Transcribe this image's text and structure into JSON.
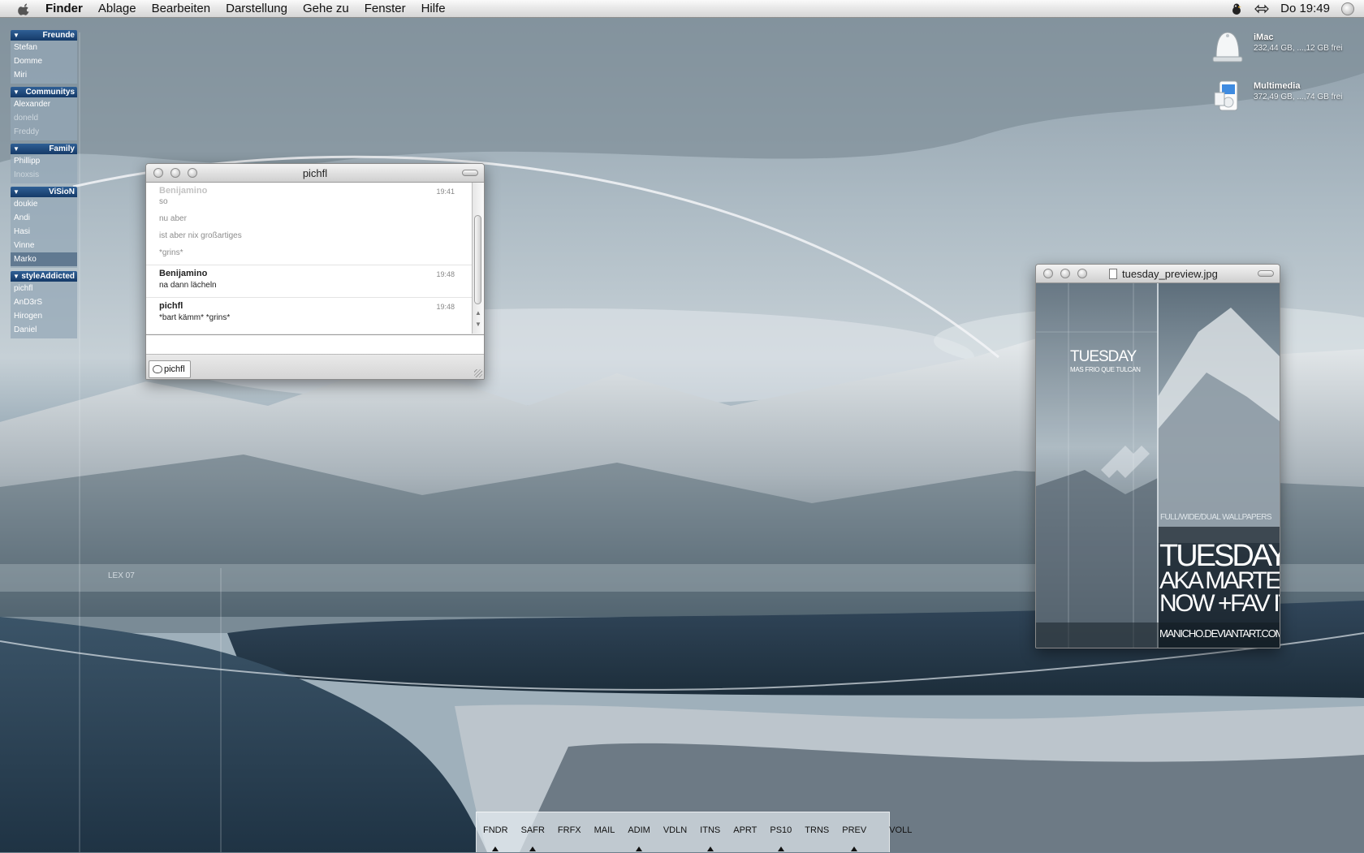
{
  "menubar": {
    "items": [
      "Finder",
      "Ablage",
      "Bearbeiten",
      "Darstellung",
      "Gehe zu",
      "Fenster",
      "Hilfe"
    ],
    "clock": "Do 19:49"
  },
  "buddy_list": {
    "groups": [
      {
        "name": "Freunde",
        "buddies": [
          {
            "name": "Stefan",
            "status": "online"
          },
          {
            "name": "Domme",
            "status": "online"
          },
          {
            "name": "Miri",
            "status": "online"
          }
        ]
      },
      {
        "name": "Communitys",
        "buddies": [
          {
            "name": "Alexander",
            "status": "online"
          },
          {
            "name": "doneld",
            "status": "away"
          },
          {
            "name": "Freddy",
            "status": "away"
          }
        ]
      },
      {
        "name": "Family",
        "buddies": [
          {
            "name": "Phillipp",
            "status": "online"
          },
          {
            "name": "Inoxsis",
            "status": "away"
          }
        ]
      },
      {
        "name": "ViSioN",
        "buddies": [
          {
            "name": "doukie",
            "status": "online"
          },
          {
            "name": "Andi",
            "status": "online"
          },
          {
            "name": "Hasi",
            "status": "online"
          },
          {
            "name": "Vinne",
            "status": "online"
          },
          {
            "name": "Marko",
            "status": "selected"
          }
        ]
      },
      {
        "name": "styleAddicted",
        "buddies": [
          {
            "name": "pichfl",
            "status": "online"
          },
          {
            "name": "AnD3rS",
            "status": "online"
          },
          {
            "name": "Hirogen",
            "status": "online"
          },
          {
            "name": "Daniel",
            "status": "online"
          }
        ]
      }
    ]
  },
  "chat_window": {
    "title": "pichfl",
    "messages": [
      {
        "sender": "Benijamino",
        "time": "19:41",
        "lines": [
          "so",
          "nu aber",
          "ist aber nix großartiges",
          "*grins*"
        ],
        "dimmed": true
      },
      {
        "sender": "Benijamino",
        "time": "19:48",
        "lines": [
          "na dann lächeln"
        ],
        "dimmed": false
      },
      {
        "sender": "pichfl",
        "time": "19:48",
        "lines": [
          "*bart kämm* *grins*"
        ],
        "dimmed": false
      }
    ],
    "tab_label": "pichfl"
  },
  "preview_window": {
    "title": "tuesday_preview.jpg",
    "image_text": {
      "small_title": "TUESDAY",
      "small_sub": "MAS FRIO QUE TULCAN",
      "tagline": "FULL/WIDE/DUAL WALLPAPERS",
      "big_1": "TUESDAY",
      "big_2": "AKA MARTES",
      "big_3": "NOW +FAV IT",
      "credit": "MANICHO.DEVIANTART.COM"
    }
  },
  "desktop_icons": [
    {
      "name": "iMac",
      "info": "232,44 GB, ...,12 GB frei",
      "icon": "hard-drive-icon"
    },
    {
      "name": "Multimedia",
      "info": "372,49 GB, ...,74 GB frei",
      "icon": "ipod-drive-icon"
    }
  ],
  "wallpaper_text": {
    "mark": "LEX 07"
  },
  "dock": {
    "items": [
      {
        "label": "FNDR",
        "running": true
      },
      {
        "label": "SAFR",
        "running": true
      },
      {
        "label": "FRFX",
        "running": false
      },
      {
        "label": "MAIL",
        "running": false
      },
      {
        "label": "ADIM",
        "running": true
      },
      {
        "label": "VDLN",
        "running": false
      },
      {
        "label": "ITNS",
        "running": true
      },
      {
        "label": "APRT",
        "running": false
      },
      {
        "label": "PS10",
        "running": true
      },
      {
        "label": "TRNS",
        "running": false
      },
      {
        "label": "PREV",
        "running": true
      }
    ],
    "trash_label": "VOLL"
  }
}
